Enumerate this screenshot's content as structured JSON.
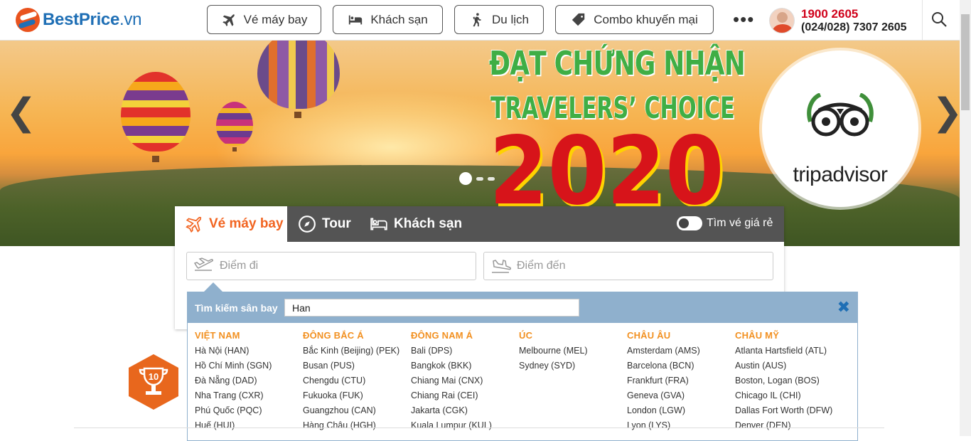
{
  "header": {
    "logo_text": "BestPrice",
    "logo_domain": ".vn",
    "nav": [
      {
        "label": "Vé máy bay",
        "icon": "airplane-icon"
      },
      {
        "label": "Khách sạn",
        "icon": "bed-icon"
      },
      {
        "label": "Du lịch",
        "icon": "hiker-icon"
      },
      {
        "label": "Combo khuyến mại",
        "icon": "tag-icon"
      }
    ],
    "more_label": "•••",
    "hotline_primary": "1900 2605",
    "hotline_secondary": "(024/028) 7307 2605"
  },
  "banner": {
    "headline_1": "ĐẠT CHỨNG NHẬN",
    "headline_2": "TRAVELERS’ CHOICE",
    "year": "2020",
    "badge_text": "tripadvisor",
    "prev_arrow": "❮",
    "next_arrow": "❯",
    "slide_count": 3,
    "active_slide": 1
  },
  "search": {
    "tabs": [
      {
        "label": "Vé máy bay",
        "icon": "plane-icon",
        "active": true
      },
      {
        "label": "Tour",
        "icon": "compass-icon",
        "active": false
      },
      {
        "label": "Khách sạn",
        "icon": "hotel-bed-icon",
        "active": false
      }
    ],
    "toggle_label": "Tìm vé giá rẻ",
    "from_placeholder": "Điểm đi",
    "to_placeholder": "Điểm đến"
  },
  "airport_search": {
    "label": "Tìm kiếm sân bay",
    "query": "Han",
    "close_icon": "✖",
    "regions": [
      {
        "name": "VIỆT NAM",
        "airports": [
          "Hà Nội (HAN)",
          "Hồ Chí Minh (SGN)",
          "Đà Nẵng (DAD)",
          "Nha Trang (CXR)",
          "Phú Quốc (PQC)",
          "Huế (HUI)"
        ]
      },
      {
        "name": "ĐÔNG BẮC Á",
        "airports": [
          "Bắc Kinh (Beijing) (PEK)",
          "Busan (PUS)",
          "Chengdu (CTU)",
          "Fukuoka (FUK)",
          "Guangzhou (CAN)",
          "Hàng Châu (HGH)"
        ]
      },
      {
        "name": "ĐÔNG NAM Á",
        "airports": [
          "Bali (DPS)",
          "Bangkok (BKK)",
          "Chiang Mai (CNX)",
          "Chiang Rai (CEI)",
          "Jakarta (CGK)",
          "Kuala Lumpur (KUL)"
        ]
      },
      {
        "name": "ÚC",
        "airports": [
          "Melbourne (MEL)",
          "Sydney (SYD)"
        ]
      },
      {
        "name": "CHÂU ÂU",
        "airports": [
          "Amsterdam (AMS)",
          "Barcelona (BCN)",
          "Frankfurt (FRA)",
          "Geneva (GVA)",
          "London (LGW)",
          "Lyon (LYS)"
        ]
      },
      {
        "name": "CHÂU MỸ",
        "airports": [
          "Atlanta Hartsfield (ATL)",
          "Austin (AUS)",
          "Boston, Logan (BOS)",
          "Chicago IL (CHI)",
          "Dallas Fort Worth (DFW)",
          "Denver (DEN)"
        ]
      }
    ]
  },
  "colors": {
    "brand_blue": "#1f6fb5",
    "brand_orange": "#f26522",
    "hotline_red": "#d0021b",
    "region_orange": "#f29122",
    "dropdown_header": "#8fb0cd"
  }
}
